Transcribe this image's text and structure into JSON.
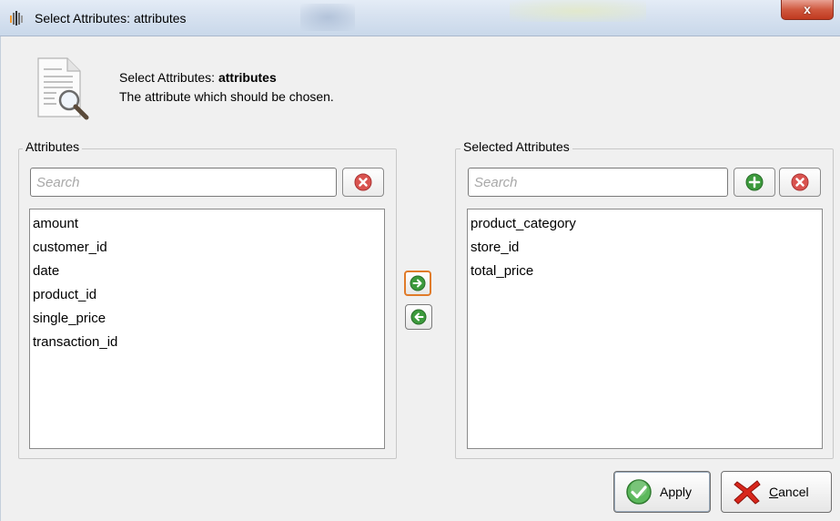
{
  "window": {
    "title": "Select Attributes: attributes",
    "close_label": "x"
  },
  "header": {
    "title_prefix": "Select Attributes: ",
    "title_param": "attributes",
    "description": "The attribute which should be chosen."
  },
  "left_panel": {
    "label": "Attributes",
    "search_placeholder": "Search",
    "items": [
      "amount",
      "customer_id",
      "date",
      "product_id",
      "single_price",
      "transaction_id"
    ]
  },
  "right_panel": {
    "label": "Selected Attributes",
    "search_placeholder": "Search",
    "items": [
      "product_category",
      "store_id",
      "total_price"
    ]
  },
  "buttons": {
    "apply_label": "Apply",
    "cancel_label": "Cancel"
  },
  "colors": {
    "clear_icon": "#d9534f",
    "add_icon": "#3c9a3c",
    "arrow_icon": "#3c9a3c",
    "focus_border": "#e07b2a"
  }
}
